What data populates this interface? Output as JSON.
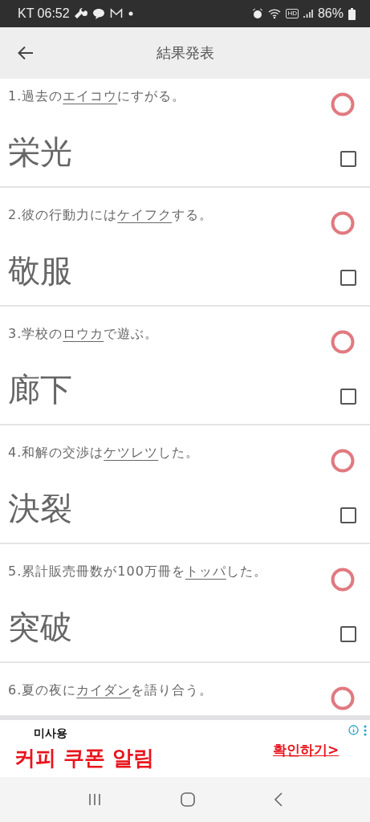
{
  "status_bar": {
    "time": "KT 06:52",
    "hd_label": "HD",
    "battery": "86%"
  },
  "app_bar": {
    "title": "結果発表"
  },
  "questions": [
    {
      "number": "1.",
      "before": "過去の",
      "target": "エイコウ",
      "after": "にすがる。",
      "correct": true,
      "answer": "栄光",
      "checked": false
    },
    {
      "number": "2.",
      "before": "彼の行動力には",
      "target": "ケイフク",
      "after": "する。",
      "correct": true,
      "answer": "敬服",
      "checked": false
    },
    {
      "number": "3.",
      "before": "学校の",
      "target": "ロウカ",
      "after": "で遊ぶ。",
      "correct": true,
      "answer": "廊下",
      "checked": false
    },
    {
      "number": "4.",
      "before": "和解の交渉は",
      "target": "ケツレツ",
      "after": "した。",
      "correct": true,
      "answer": "決裂",
      "checked": false
    },
    {
      "number": "5.",
      "before": "累計販売冊数が100万冊を",
      "target": "トッパ",
      "after": "した。",
      "correct": true,
      "answer": "突破",
      "checked": false
    },
    {
      "number": "6.",
      "before": "夏の夜に",
      "target": "カイダン",
      "after": "を語り合う。",
      "correct": true
    }
  ],
  "ad": {
    "subtitle": "미사용",
    "headline": "커피 쿠폰 알림",
    "link": "확인하기>"
  }
}
